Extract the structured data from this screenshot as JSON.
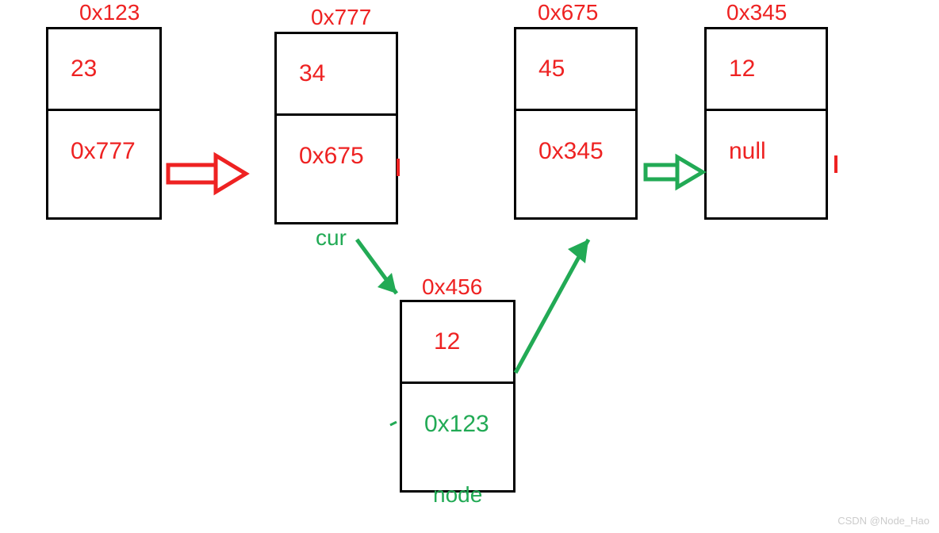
{
  "nodes": {
    "n1": {
      "addr": "0x123",
      "data": "23",
      "next": "0x777"
    },
    "n2": {
      "addr": "0x777",
      "data": "34",
      "next": "0x675"
    },
    "n3": {
      "addr": "0x675",
      "data": "45",
      "next": "0x345"
    },
    "n4": {
      "addr": "0x345",
      "data": "12",
      "next": "null"
    },
    "n5": {
      "addr": "0x456",
      "data": "12",
      "next": "0x123"
    }
  },
  "labels": {
    "cur": "cur",
    "node": "node"
  },
  "watermark": "CSDN @Node_Hao"
}
